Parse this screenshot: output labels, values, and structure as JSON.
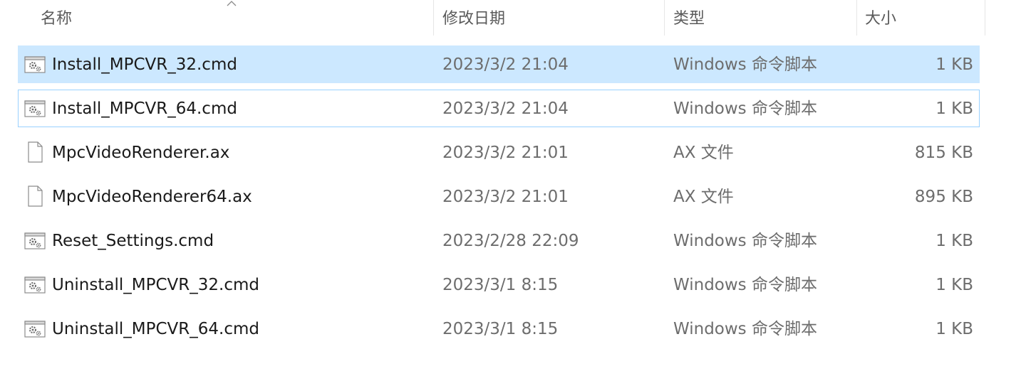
{
  "columns": {
    "name": "名称",
    "date": "修改日期",
    "type": "类型",
    "size": "大小"
  },
  "files": [
    {
      "name": "Install_MPCVR_32.cmd",
      "date": "2023/3/2 21:04",
      "type": "Windows 命令脚本",
      "size": "1 KB",
      "icon": "cmd-script-icon",
      "state": "selected"
    },
    {
      "name": "Install_MPCVR_64.cmd",
      "date": "2023/3/2 21:04",
      "type": "Windows 命令脚本",
      "size": "1 KB",
      "icon": "cmd-script-icon",
      "state": "focused"
    },
    {
      "name": "MpcVideoRenderer.ax",
      "date": "2023/3/2 21:01",
      "type": "AX 文件",
      "size": "815 KB",
      "icon": "blank-file-icon",
      "state": "normal"
    },
    {
      "name": "MpcVideoRenderer64.ax",
      "date": "2023/3/2 21:01",
      "type": "AX 文件",
      "size": "895 KB",
      "icon": "blank-file-icon",
      "state": "normal"
    },
    {
      "name": "Reset_Settings.cmd",
      "date": "2023/2/28 22:09",
      "type": "Windows 命令脚本",
      "size": "1 KB",
      "icon": "cmd-script-icon",
      "state": "normal"
    },
    {
      "name": "Uninstall_MPCVR_32.cmd",
      "date": "2023/3/1 8:15",
      "type": "Windows 命令脚本",
      "size": "1 KB",
      "icon": "cmd-script-icon",
      "state": "normal"
    },
    {
      "name": "Uninstall_MPCVR_64.cmd",
      "date": "2023/3/1 8:15",
      "type": "Windows 命令脚本",
      "size": "1 KB",
      "icon": "cmd-script-icon",
      "state": "normal"
    }
  ],
  "colors": {
    "selected_bg": "#cce8ff",
    "focus_border": "#99d1ff"
  }
}
